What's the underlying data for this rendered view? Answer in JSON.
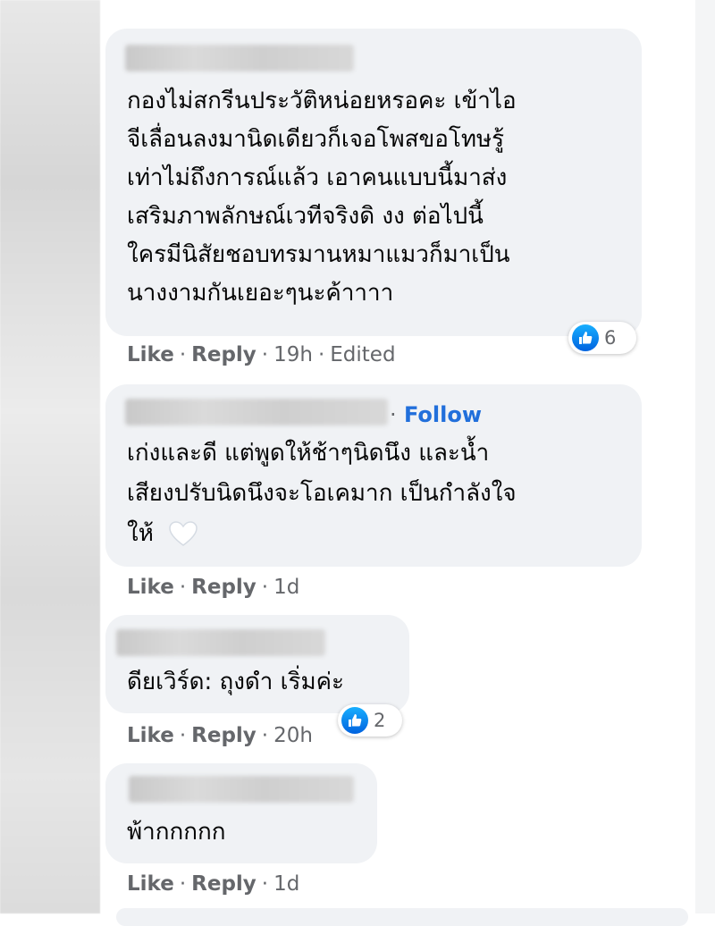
{
  "comments": [
    {
      "lines": [
        "กองไม่สกรีนประวัติหน่อยหรอคะ เข้าไอ",
        "จีเลื่อนลงมานิดเดียวก็เจอโพสขอโทษรู้",
        "เท่าไม่ถึงการณ์แล้ว เอาคนแบบนี้มาส่ง",
        "เสริมภาพลักษณ์เวทีจริงดิ งง ต่อไปนี้",
        "ใครมีนิสัยชอบทรมานหมาแมวก็มาเป็น",
        "นางงามกันเยอะๆนะค้าาาา"
      ],
      "like": "Like",
      "reply": "Reply",
      "time": "19h",
      "edited": "Edited",
      "reaction_count": "6"
    },
    {
      "follow": "Follow",
      "lines": [
        "เก่งและดี แต่พูดให้ช้าๆนิดนึง และน้ำ",
        "เสียงปรับนิดนึงจะโอเคมาก เป็นกำลังใจ",
        "ให้"
      ],
      "like": "Like",
      "reply": "Reply",
      "time": "1d"
    },
    {
      "lines": [
        "ดียเวิร์ด: ถุงดำ เริ่มค่ะ"
      ],
      "like": "Like",
      "reply": "Reply",
      "time": "20h",
      "reaction_count": "2"
    },
    {
      "lines": [
        "พ้ากกกกก"
      ],
      "like": "Like",
      "reply": "Reply",
      "time": "1d"
    }
  ],
  "separators": {
    "dot": "·"
  },
  "icons": {
    "like": "like-thumb-icon",
    "heart": "white-heart-emoji-icon"
  },
  "colors": {
    "bubble": "#f0f2f5",
    "link_blue": "#216fdb",
    "meta_gray": "#65676b",
    "like_blue": "#0062df"
  }
}
